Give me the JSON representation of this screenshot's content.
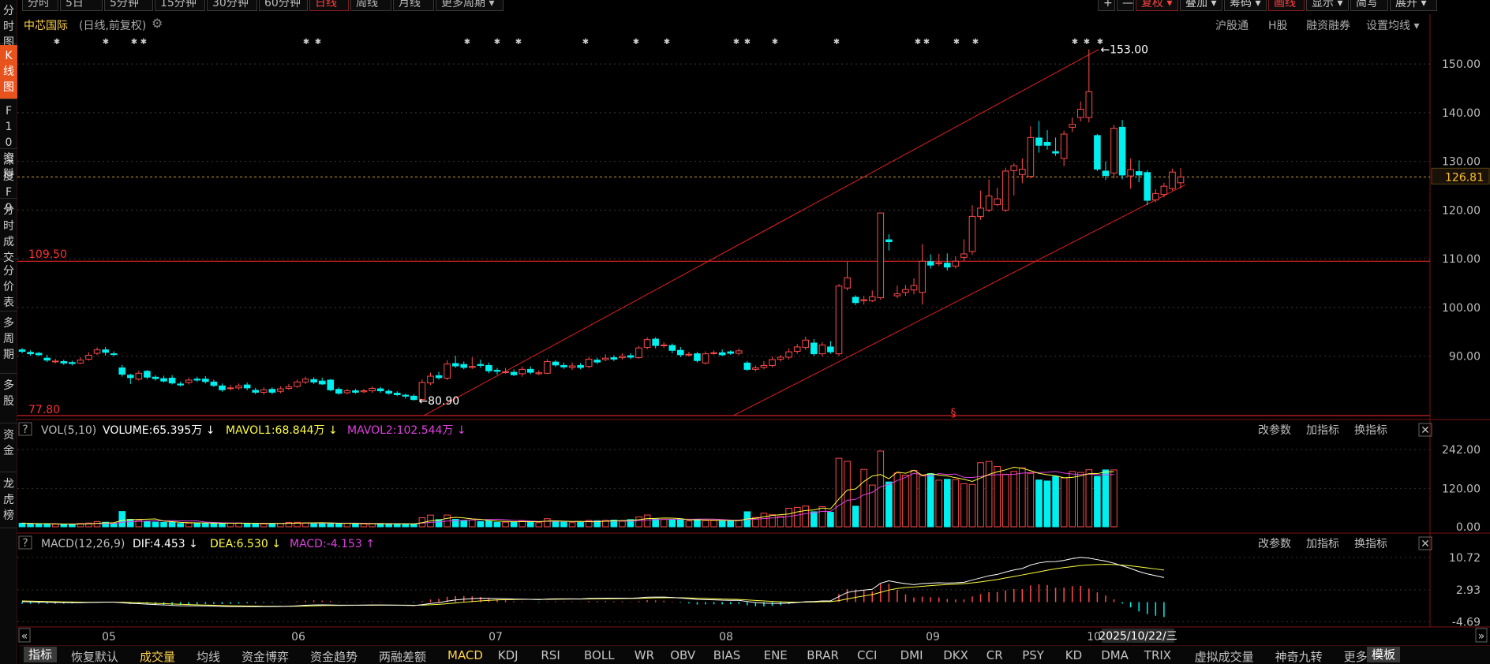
{
  "top_periods": [
    {
      "label": "分时"
    },
    {
      "label": "5日"
    },
    {
      "label": "5分钟"
    },
    {
      "label": "15分钟"
    },
    {
      "label": "30分钟"
    },
    {
      "label": "60分钟"
    },
    {
      "label": "日线",
      "active": true
    },
    {
      "label": "周线"
    },
    {
      "label": "月线"
    },
    {
      "label": "更多周期 ▾"
    }
  ],
  "top_right": [
    {
      "label": "+"
    },
    {
      "label": "—"
    },
    {
      "label": "复权 ▾",
      "red": true
    },
    {
      "label": "叠加 ▾"
    },
    {
      "label": "筹码 ▾"
    },
    {
      "label": "画线",
      "red": true
    },
    {
      "label": "显示 ▾"
    },
    {
      "label": "简写"
    },
    {
      "label": "展开 ▾"
    }
  ],
  "sidebar": [
    {
      "label": "分时图"
    },
    {
      "label": "K线图",
      "active": true
    },
    {
      "label": "F10资料"
    },
    {
      "label": "深度F9"
    },
    {
      "label": "分时成交"
    },
    {
      "label": "分价表"
    },
    {
      "label": "多周期"
    },
    {
      "label": "多股"
    },
    {
      "label": "资金"
    },
    {
      "label": "龙虎榜"
    }
  ],
  "header": {
    "title": "中芯国际",
    "subtitle": "(日线,前复权)",
    "links": [
      "沪股通",
      "H股",
      "融资融券",
      "设置均线 ▾"
    ]
  },
  "price_axis": {
    "ticks": [
      "150.00",
      "140.00",
      "130.00",
      "120.00",
      "110.00",
      "100.00",
      "90.00"
    ],
    "current": "126.81"
  },
  "annotations": {
    "high_label": "153.00",
    "low_label": "80.90",
    "level_high": "109.50",
    "level_low": "77.80"
  },
  "x_axis": {
    "months": [
      "05",
      "06",
      "07",
      "08",
      "09",
      "10"
    ],
    "date_cursor": "2025/10/22/三"
  },
  "volume_panel": {
    "name": "VOL(5,10)",
    "volume": "VOLUME:65.395万 ↓",
    "ma1": "MAVOL1:68.844万 ↓",
    "ma2": "MAVOL2:102.544万 ↓",
    "axis": [
      "242.00",
      "120.00",
      "0.00"
    ],
    "actions": [
      "改参数",
      "加指标",
      "换指标"
    ]
  },
  "macd_panel": {
    "name": "MACD(12,26,9)",
    "dif": "DIF:4.453 ↓",
    "dea": "DEA:6.530 ↓",
    "macd": "MACD:-4.153 ↑",
    "axis": [
      "10.72",
      "2.93",
      "-4.69"
    ],
    "actions": [
      "改参数",
      "加指标",
      "换指标"
    ]
  },
  "bottom_tabs": [
    {
      "label": "指标",
      "first": true
    },
    {
      "label": "恢复默认"
    },
    {
      "label": "成交量",
      "active": true
    },
    {
      "label": "均线"
    },
    {
      "label": "资金博弈"
    },
    {
      "label": "资金趋势"
    },
    {
      "label": "两融差额"
    },
    {
      "label": "MACD",
      "active": true
    },
    {
      "label": "KDJ"
    },
    {
      "label": "RSI"
    },
    {
      "label": "BOLL"
    },
    {
      "label": "WR"
    },
    {
      "label": "OBV"
    },
    {
      "label": "BIAS"
    },
    {
      "label": "ENE"
    },
    {
      "label": "BRAR"
    },
    {
      "label": "CCI"
    },
    {
      "label": "DMI"
    },
    {
      "label": "DKX"
    },
    {
      "label": "CR"
    },
    {
      "label": "PSY"
    },
    {
      "label": "KD"
    },
    {
      "label": "DMA"
    },
    {
      "label": "TRIX"
    },
    {
      "label": "虚拟成交量"
    },
    {
      "label": "神奇九转"
    },
    {
      "label": "更多指标"
    },
    {
      "label": "模板",
      "first": true
    }
  ],
  "colors": {
    "up": "#ff4a4a",
    "down": "#00f0f0",
    "ma1": "#ffff40",
    "ma2": "#e040e0",
    "dif": "#ffffff",
    "dea": "#ffff40",
    "title": "#ffd24a"
  },
  "chart_data": {
    "type": "candlestick",
    "price_range": [
      77.0,
      156.0
    ],
    "candles": [
      [
        91.3,
        91.0,
        91.7,
        90.6
      ],
      [
        90.8,
        90.5,
        91.2,
        90.1
      ],
      [
        90.6,
        90.3,
        90.9,
        90.0
      ],
      [
        89.6,
        89.2,
        90.3,
        88.8
      ],
      [
        88.9,
        89.0,
        89.5,
        88.5
      ],
      [
        88.9,
        88.6,
        89.3,
        88.2
      ],
      [
        88.7,
        88.5,
        89.1,
        88.1
      ],
      [
        88.6,
        89.2,
        89.8,
        88.4
      ],
      [
        89.4,
        90.2,
        90.8,
        89.1
      ],
      [
        90.6,
        91.3,
        91.8,
        90.2
      ],
      [
        91.3,
        90.8,
        91.9,
        90.1
      ],
      [
        90.5,
        90.4,
        91.0,
        90.0
      ],
      [
        87.6,
        86.3,
        88.2,
        85.8
      ],
      [
        86.1,
        85.6,
        86.4,
        84.3
      ],
      [
        85.3,
        86.5,
        87.0,
        85.0
      ],
      [
        86.9,
        85.7,
        87.2,
        85.3
      ],
      [
        85.7,
        85.4,
        86.1,
        85.0
      ],
      [
        85.4,
        84.9,
        86.0,
        84.6
      ],
      [
        85.5,
        84.5,
        86.1,
        84.2
      ],
      [
        84.3,
        84.1,
        84.8,
        83.8
      ],
      [
        84.6,
        85.1,
        85.6,
        84.2
      ],
      [
        85.3,
        85.1,
        85.8,
        84.7
      ],
      [
        85.3,
        84.8,
        85.9,
        84.4
      ],
      [
        84.7,
        84.0,
        85.2,
        83.7
      ],
      [
        83.9,
        83.1,
        84.4,
        82.7
      ],
      [
        83.4,
        83.5,
        84.1,
        83.0
      ],
      [
        83.5,
        83.9,
        84.4,
        83.1
      ],
      [
        84.1,
        83.5,
        84.6,
        83.0
      ],
      [
        83.0,
        82.6,
        83.5,
        82.2
      ],
      [
        82.6,
        83.1,
        83.6,
        82.1
      ],
      [
        83.2,
        82.6,
        83.6,
        82.2
      ],
      [
        82.8,
        83.3,
        83.8,
        82.4
      ],
      [
        83.4,
        83.7,
        84.3,
        83.1
      ],
      [
        83.8,
        84.7,
        85.2,
        83.5
      ],
      [
        84.7,
        85.3,
        85.8,
        84.3
      ],
      [
        85.2,
        84.7,
        85.7,
        84.3
      ],
      [
        84.9,
        84.3,
        85.6,
        84.1
      ],
      [
        85.1,
        83.1,
        85.3,
        82.8
      ],
      [
        83.2,
        82.4,
        83.6,
        82.1
      ],
      [
        82.5,
        82.9,
        83.3,
        82.2
      ],
      [
        82.9,
        82.6,
        83.3,
        82.3
      ],
      [
        82.7,
        82.9,
        83.3,
        82.4
      ],
      [
        82.9,
        83.4,
        83.8,
        82.5
      ],
      [
        83.3,
        82.9,
        83.7,
        82.5
      ],
      [
        82.8,
        82.4,
        83.2,
        82.1
      ],
      [
        82.4,
        82.1,
        82.8,
        81.8
      ],
      [
        82.0,
        81.8,
        82.3,
        81.3
      ],
      [
        81.8,
        81.1,
        82.2,
        80.9
      ],
      [
        81.1,
        84.6,
        85.2,
        80.9
      ],
      [
        84.5,
        85.9,
        86.6,
        84.1
      ],
      [
        86.0,
        85.6,
        86.8,
        85.2
      ],
      [
        85.5,
        88.4,
        89.2,
        85.1
      ],
      [
        88.5,
        88.0,
        90.1,
        87.6
      ],
      [
        88.3,
        87.7,
        88.9,
        87.3
      ],
      [
        87.7,
        87.9,
        89.8,
        87.4
      ],
      [
        88.3,
        88.1,
        89.3,
        87.6
      ],
      [
        88.1,
        87.0,
        88.7,
        86.5
      ],
      [
        87.1,
        86.9,
        87.6,
        86.2
      ],
      [
        86.8,
        86.8,
        87.6,
        86.4
      ],
      [
        86.7,
        86.2,
        87.3,
        85.9
      ],
      [
        86.4,
        87.3,
        87.9,
        85.8
      ],
      [
        87.3,
        86.7,
        87.9,
        86.3
      ],
      [
        86.4,
        86.6,
        87.1,
        86.1
      ],
      [
        86.5,
        88.9,
        89.4,
        86.3
      ],
      [
        88.8,
        88.2,
        89.2,
        87.8
      ],
      [
        88.1,
        87.8,
        88.7,
        87.4
      ],
      [
        87.7,
        88.0,
        88.7,
        87.2
      ],
      [
        88.1,
        87.7,
        88.6,
        87.3
      ],
      [
        87.9,
        89.4,
        89.9,
        87.5
      ],
      [
        89.2,
        88.8,
        89.7,
        88.4
      ],
      [
        89.3,
        89.6,
        90.4,
        89.0
      ],
      [
        89.7,
        89.4,
        90.2,
        89.0
      ],
      [
        89.7,
        90.0,
        90.6,
        89.3
      ],
      [
        90.1,
        89.8,
        90.6,
        89.4
      ],
      [
        89.7,
        91.7,
        92.1,
        89.5
      ],
      [
        91.8,
        93.4,
        93.9,
        91.4
      ],
      [
        93.5,
        92.2,
        93.9,
        91.6
      ],
      [
        92.2,
        92.3,
        92.9,
        91.7
      ],
      [
        92.2,
        91.2,
        92.6,
        90.6
      ],
      [
        91.2,
        90.3,
        91.9,
        89.8
      ],
      [
        90.4,
        90.4,
        90.9,
        89.9
      ],
      [
        90.5,
        89.1,
        90.9,
        88.7
      ],
      [
        88.6,
        90.5,
        91.0,
        88.3
      ],
      [
        90.6,
        90.7,
        91.2,
        90.3
      ],
      [
        90.7,
        90.3,
        91.4,
        90.0
      ],
      [
        90.9,
        90.6,
        91.2,
        90.3
      ],
      [
        90.6,
        91.1,
        91.6,
        90.2
      ],
      [
        88.6,
        87.3,
        89.0,
        87.0
      ],
      [
        87.3,
        87.6,
        88.1,
        86.9
      ],
      [
        87.7,
        88.1,
        89.0,
        87.3
      ],
      [
        88.1,
        89.3,
        89.9,
        87.7
      ],
      [
        89.4,
        89.8,
        90.3,
        88.9
      ],
      [
        89.8,
        90.9,
        91.6,
        89.3
      ],
      [
        91.0,
        91.9,
        92.5,
        90.5
      ],
      [
        91.8,
        93.3,
        94.0,
        91.3
      ],
      [
        92.7,
        90.5,
        93.5,
        90.1
      ],
      [
        90.5,
        92.3,
        92.9,
        89.9
      ],
      [
        91.9,
        90.9,
        93.1,
        90.5
      ],
      [
        90.5,
        104.4,
        104.8,
        90.0
      ],
      [
        104.0,
        106.1,
        109.4,
        103.5
      ],
      [
        102.1,
        101.0,
        102.5,
        100.5
      ],
      [
        101.4,
        101.6,
        102.4,
        100.6
      ],
      [
        101.4,
        102.2,
        103.5,
        101.1
      ],
      [
        102.0,
        119.4,
        119.4,
        101.6
      ],
      [
        113.9,
        113.5,
        115.0,
        111.7
      ],
      [
        102.4,
        102.8,
        104.5,
        101.9
      ],
      [
        103.1,
        103.7,
        104.6,
        102.4
      ],
      [
        103.6,
        104.5,
        106.0,
        102.7
      ],
      [
        103.1,
        109.5,
        113.0,
        100.6
      ],
      [
        109.4,
        108.7,
        110.9,
        108.0
      ],
      [
        109.0,
        109.2,
        111.0,
        108.5
      ],
      [
        109.1,
        108.3,
        111.1,
        107.6
      ],
      [
        108.5,
        109.5,
        110.5,
        108.0
      ],
      [
        110.3,
        111.0,
        114.0,
        109.5
      ],
      [
        111.5,
        118.7,
        121.0,
        110.8
      ],
      [
        118.7,
        120.4,
        124.0,
        118.0
      ],
      [
        120.0,
        122.9,
        126.3,
        119.6
      ],
      [
        121.1,
        122.3,
        124.6,
        120.8
      ],
      [
        120.0,
        128.0,
        128.7,
        119.6
      ],
      [
        128.1,
        129.1,
        129.6,
        123.0
      ],
      [
        127.3,
        128.4,
        130.6,
        125.5
      ],
      [
        126.9,
        134.9,
        137.2,
        126.5
      ],
      [
        134.8,
        133.3,
        138.3,
        131.8
      ],
      [
        133.9,
        133.3,
        136.4,
        132.4
      ],
      [
        132.0,
        131.7,
        134.9,
        131.1
      ],
      [
        130.6,
        135.6,
        136.3,
        129.0
      ],
      [
        137.0,
        137.6,
        139.0,
        136.0
      ],
      [
        139.0,
        140.7,
        142.3,
        138.2
      ],
      [
        139.0,
        144.3,
        153.0,
        138.0
      ],
      [
        135.3,
        128.4,
        135.6,
        128.0
      ],
      [
        128.0,
        127.1,
        130.0,
        126.2
      ],
      [
        127.6,
        136.8,
        137.5,
        126.5
      ],
      [
        137.0,
        127.2,
        138.5,
        126.3
      ],
      [
        127.0,
        128.3,
        130.6,
        124.4
      ],
      [
        127.9,
        127.2,
        130.2,
        125.7
      ],
      [
        127.7,
        122.0,
        128.2,
        121.0
      ],
      [
        122.1,
        123.4,
        124.3,
        121.6
      ],
      [
        123.2,
        124.9,
        125.6,
        122.6
      ],
      [
        124.4,
        127.8,
        128.5,
        124.0
      ],
      [
        125.6,
        126.8,
        128.6,
        124.4
      ]
    ],
    "volume": [
      4.2,
      3.5,
      3.2,
      3.6,
      3.0,
      2.8,
      3.0,
      3.9,
      4.4,
      6.1,
      5.3,
      3.9,
      17.8,
      8.7,
      7.6,
      6.2,
      5.4,
      5.1,
      5.3,
      3.9,
      4.2,
      4.6,
      4.1,
      4.6,
      3.4,
      4.2,
      4.5,
      3.9,
      3.9,
      3.3,
      3.9,
      4.0,
      5.1,
      5.2,
      4.4,
      4.4,
      4.3,
      4.3,
      3.2,
      4.0,
      3.6,
      3.4,
      3.6,
      3.5,
      3.2,
      3.4,
      3.4,
      3.4,
      10.5,
      13.6,
      8.4,
      13.7,
      8.7,
      7.2,
      7.8,
      6.1,
      6.8,
      5.2,
      5.4,
      5.6,
      6.9,
      6.5,
      4.8,
      9.4,
      6.8,
      5.4,
      4.8,
      5.1,
      7.4,
      7.1,
      7.5,
      7.8,
      6.5,
      8.4,
      11.4,
      13.7,
      8.8,
      8.5,
      8.0,
      8.8,
      6.8,
      8.7,
      7.4,
      7.4,
      7.0,
      6.4,
      7.6,
      17.5,
      10.9,
      15.8,
      14.1,
      12.4,
      21.6,
      22.6,
      24.1,
      17.5,
      23.4,
      16.9,
      79.8,
      76.3,
      24.0,
      66.9,
      48.6,
      88.2,
      52.2,
      62.7,
      60.1,
      65.7,
      59.2,
      61.9,
      54.3,
      55.3,
      54.9,
      50.2,
      49.3,
      74.6,
      76.1,
      70.2,
      61.2,
      64.5,
      68.6,
      62.2,
      54.5,
      53.3,
      58.6,
      56.9,
      64.4,
      63.3,
      66.4,
      58.7,
      66.2,
      66.2
    ],
    "dif": [
      0.1,
      0.05,
      0.0,
      -0.05,
      -0.08,
      -0.12,
      -0.14,
      -0.13,
      -0.1,
      -0.04,
      0.0,
      0.01,
      -0.15,
      -0.3,
      -0.38,
      -0.49,
      -0.58,
      -0.68,
      -0.77,
      -0.86,
      -0.89,
      -0.9,
      -0.92,
      -0.97,
      -1.04,
      -1.07,
      -1.07,
      -1.08,
      -1.11,
      -1.09,
      -1.09,
      -1.05,
      -0.99,
      -0.88,
      -0.75,
      -0.68,
      -0.65,
      -0.67,
      -0.72,
      -0.72,
      -0.72,
      -0.71,
      -0.68,
      -0.68,
      -0.7,
      -0.73,
      -0.77,
      -0.83,
      -0.61,
      -0.33,
      -0.14,
      0.25,
      0.52,
      0.69,
      0.83,
      0.92,
      0.9,
      0.86,
      0.82,
      0.73,
      0.72,
      0.66,
      0.59,
      0.73,
      0.78,
      0.79,
      0.79,
      0.77,
      0.87,
      0.9,
      0.94,
      0.94,
      0.95,
      0.92,
      1.01,
      1.19,
      1.22,
      1.22,
      1.12,
      0.97,
      0.84,
      0.64,
      0.6,
      0.55,
      0.47,
      0.44,
      0.43,
      0.14,
      -0.09,
      -0.24,
      -0.3,
      -0.3,
      -0.23,
      -0.1,
      0.11,
      0.15,
      0.28,
      0.3,
      1.34,
      2.31,
      2.64,
      2.89,
      3.08,
      4.53,
      5.1,
      4.73,
      4.42,
      4.19,
      4.45,
      4.53,
      4.64,
      4.57,
      4.63,
      4.75,
      5.28,
      5.8,
      6.32,
      6.63,
      7.21,
      7.71,
      8.06,
      8.88,
      9.39,
      9.68,
      9.7,
      10.0,
      10.42,
      10.72,
      10.53,
      10.17,
      9.83,
      9.32,
      8.69,
      8.06,
      7.33,
      6.76,
      6.33,
      5.89
    ],
    "dea": [
      0.3,
      0.25,
      0.2,
      0.15,
      0.1,
      0.06,
      0.02,
      -0.01,
      -0.03,
      -0.03,
      -0.02,
      -0.01,
      -0.04,
      -0.09,
      -0.15,
      -0.21,
      -0.29,
      -0.36,
      -0.44,
      -0.52,
      -0.59,
      -0.65,
      -0.7,
      -0.75,
      -0.81,
      -0.86,
      -0.9,
      -0.94,
      -0.97,
      -1.0,
      -1.02,
      -1.02,
      -1.01,
      -0.98,
      -0.93,
      -0.88,
      -0.83,
      -0.8,
      -0.79,
      -0.77,
      -0.76,
      -0.75,
      -0.74,
      -0.73,
      -0.72,
      -0.72,
      -0.73,
      -0.75,
      -0.72,
      -0.64,
      -0.54,
      -0.38,
      -0.2,
      -0.03,
      0.14,
      0.3,
      0.43,
      0.52,
      0.6,
      0.63,
      0.66,
      0.66,
      0.65,
      0.67,
      0.69,
      0.71,
      0.73,
      0.74,
      0.76,
      0.79,
      0.82,
      0.84,
      0.86,
      0.88,
      0.9,
      0.96,
      1.01,
      1.05,
      1.06,
      1.04,
      1.0,
      0.93,
      0.87,
      0.81,
      0.74,
      0.69,
      0.64,
      0.53,
      0.41,
      0.28,
      0.16,
      0.07,
      0.01,
      -0.01,
      0.01,
      0.04,
      0.09,
      0.13,
      0.37,
      0.76,
      1.13,
      1.48,
      1.8,
      2.35,
      2.9,
      3.26,
      3.49,
      3.63,
      3.79,
      3.94,
      4.08,
      4.2,
      4.31,
      4.43,
      4.6,
      4.84,
      5.13,
      5.42,
      5.79,
      6.15,
      6.51,
      6.88,
      7.26,
      7.63,
      7.98,
      8.26,
      8.51,
      8.77,
      8.91,
      9.0,
      9.04,
      8.99,
      8.87,
      8.69,
      8.45,
      8.2,
      7.95,
      7.68
    ]
  }
}
